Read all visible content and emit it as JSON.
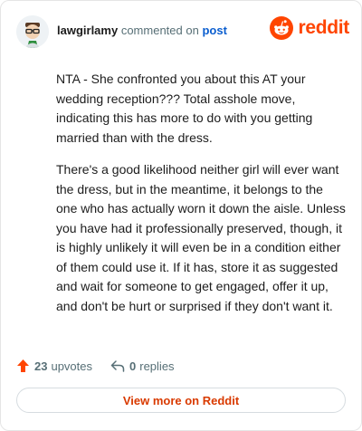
{
  "header": {
    "username": "lawgirlamy",
    "action_text": "commented on",
    "post_link": "post",
    "brand": "reddit",
    "brand_color": "#ff4500"
  },
  "comment": {
    "paragraphs": [
      "NTA - She confronted you about this AT your wedding reception??? Total asshole move, indicating this has more to do with you getting married than with the dress.",
      "There's a good likelihood neither girl will ever want the dress, but in the meantime, it belongs to the one who has actually worn it down the aisle. Unless you have had it professionally preserved, though, it is highly unlikely it will even be in a condition either of them could use it. If it has, store it as suggested and wait for someone to get engaged, offer it up, and don't be hurt or surprised if they don't want it."
    ]
  },
  "footer": {
    "upvotes_count": "23",
    "upvotes_label": "upvotes",
    "replies_count": "0",
    "replies_label": "replies",
    "view_more": "View more on Reddit",
    "upvote_icon": "upvote-arrow-icon",
    "reply_icon": "reply-arrow-icon"
  }
}
